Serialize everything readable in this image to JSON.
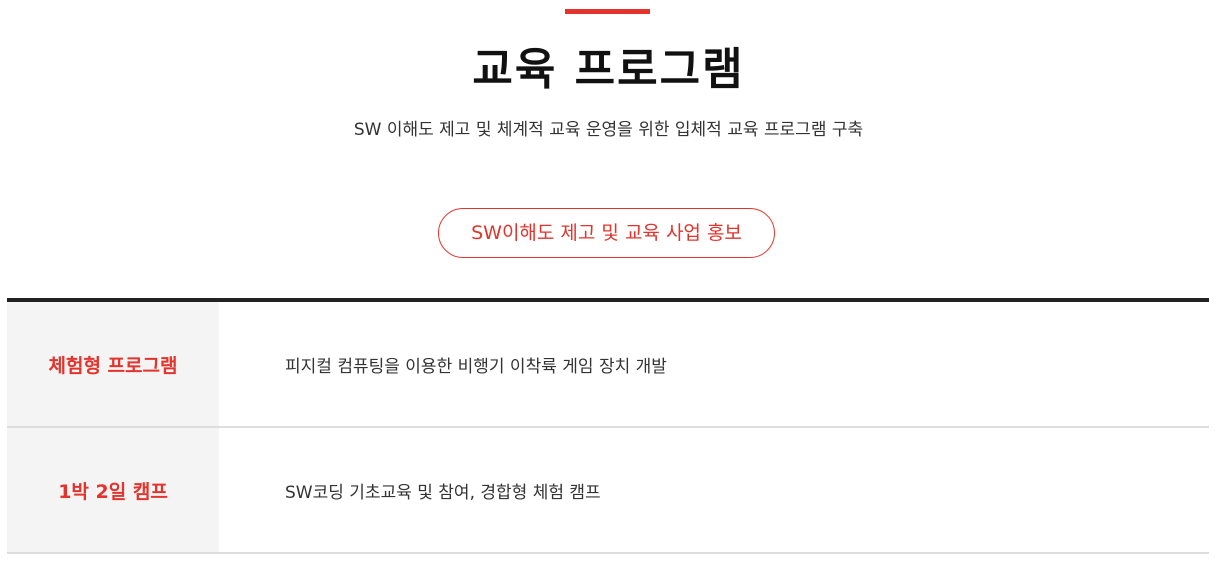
{
  "header": {
    "title": "교육 프로그램",
    "subtitle": "SW 이해도 제고 및 체계적 교육 운영을 위한 입체적 교육 프로그램 구축"
  },
  "category_button": {
    "label": "SW이해도 제고 및 교육 사업 홍보"
  },
  "programs": [
    {
      "name": "체험형 프로그램",
      "description": "피지컬 컴퓨팅을 이용한 비행기 이착륙 게임 장치 개발"
    },
    {
      "name": "1박 2일 캠프",
      "description": "SW코딩 기초교육 및 참여, 경합형 체험 캠프"
    }
  ],
  "colors": {
    "accent": "#e2342d",
    "title": "#111111",
    "body_text": "#333333",
    "row_header_bg": "#f4f4f4",
    "table_top_border": "#222222",
    "row_divider": "#dddddd"
  }
}
